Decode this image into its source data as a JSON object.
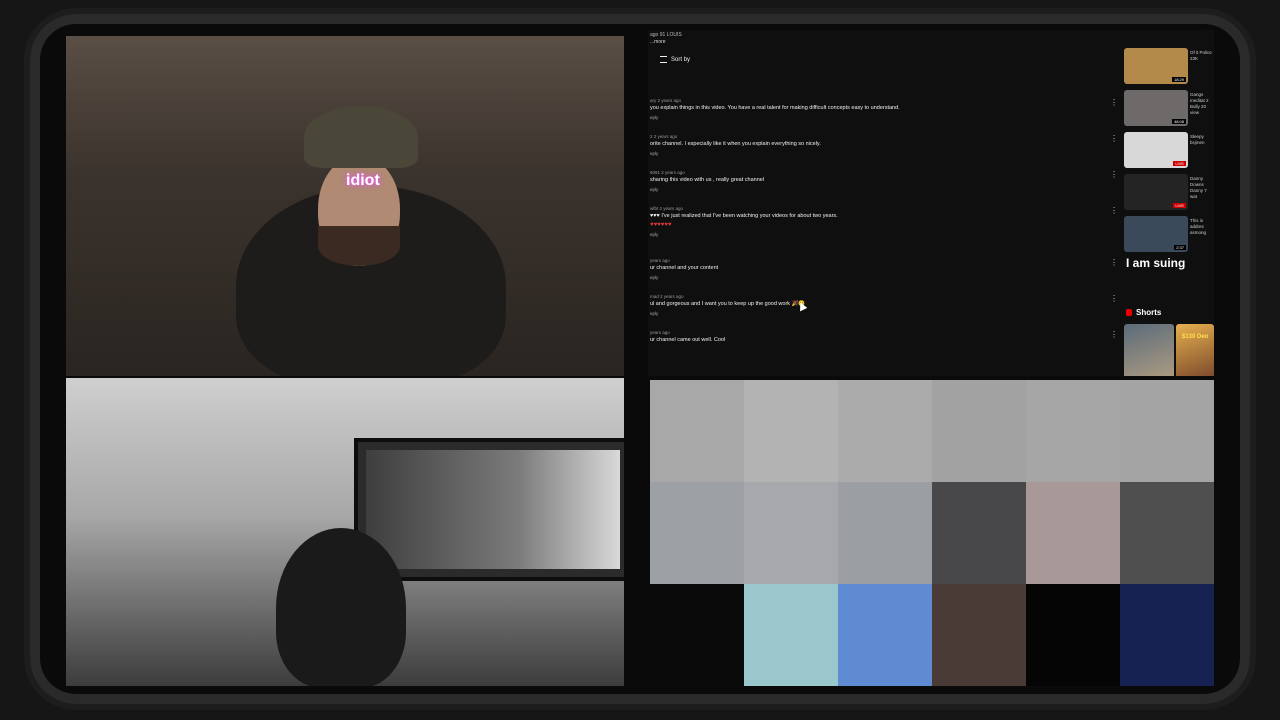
{
  "webcam": {
    "overlay_text": "idiot"
  },
  "comments": {
    "top_fragment": "ago 91 LOUIS",
    "more_label": "...more",
    "sort_label": "Sort by",
    "items": [
      {
        "meta": "ary 2 years ago",
        "text": "you explain things in this video. You have a real talent for making difficult concepts easy to understand.",
        "reply": "eply"
      },
      {
        "meta": "2 2 years ago",
        "text": "orite channel. I especially like it when you explain everything so nicely.",
        "reply": "eply"
      },
      {
        "meta": "6091 2 years ago",
        "text": "sharing this video with us , really great channel",
        "reply": "eply"
      },
      {
        "meta": "wfbt 2 years ago",
        "text": "♥♥♥ I've just realized that I've been watching your videos for about two years.",
        "hearts": "♥♥♥♥♥♥",
        "reply": "eply"
      },
      {
        "meta": "years ago",
        "text": "ur channel and your content",
        "reply": "eply"
      },
      {
        "meta": "mad 2 years ago",
        "text": "ul and gorgeous and I want you to keep up the good work 🎉😊",
        "reply": "eply"
      },
      {
        "meta": "years ago",
        "text": "ur channel came out well. Cool"
      }
    ]
  },
  "sidebar": {
    "videos": [
      {
        "label": "Of it Police 23K",
        "badge": "18:29",
        "color": "#b48a4a"
      },
      {
        "label": "Gangs meditat 2 Bully 20 view",
        "badge": "48:08",
        "color": "#6e6a6a"
      },
      {
        "label": "Sleepy bsjmen",
        "badge": "LIVE",
        "color": "#d8d8d8"
      },
      {
        "label": "Danny Downs Danny 7 wat",
        "badge": "LIVE",
        "color": "#242424"
      },
      {
        "label": "This is addres asmong",
        "badge": "2:37",
        "color": "#3a4a5a"
      }
    ],
    "big_text": "I am suing",
    "shorts_label": "Shorts",
    "short_price": "$130 Deo"
  },
  "pixel_colors": [
    "#a8a8a8",
    "#b3b3b3",
    "#ababab",
    "#a2a2a2",
    "#a6a6a6",
    "#a4a4a4",
    "#9da0a5",
    "#a6a8ac",
    "#9b9ea3",
    "#48474a",
    "#a89898",
    "#4f4f4f",
    "#0a0a0a",
    "#99c7cc",
    "#5f8bd2",
    "#4a3b36",
    "#050505",
    "#162252"
  ]
}
